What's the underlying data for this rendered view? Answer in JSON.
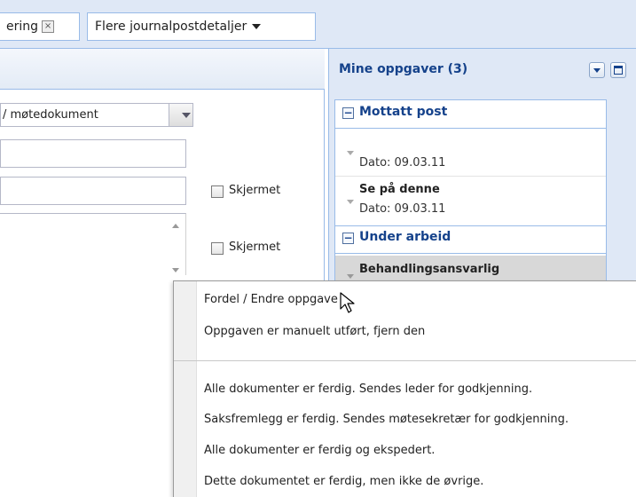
{
  "tabs": {
    "registrering": {
      "label": "ering",
      "close": "×"
    },
    "more_details": {
      "label": "Flere journalpostdetaljer"
    }
  },
  "form": {
    "document_type_value": "/ møtedokument",
    "checkbox1_label": "Skjermet",
    "checkbox2_label": "Skjermet"
  },
  "tasks_panel": {
    "title": "Mine oppgaver (3)",
    "groups": [
      {
        "title": "Mottatt post",
        "toggle": "−"
      },
      {
        "title": "Under arbeid",
        "toggle": "−"
      }
    ],
    "tasks": [
      {
        "title": "",
        "date": "Dato: 09.03.11"
      },
      {
        "title": "Se på denne",
        "date": "Dato: 09.03.11"
      },
      {
        "title": "Behandlingsansvarlig",
        "date": ""
      }
    ]
  },
  "context_menu": {
    "items_top": [
      "Fordel / Endre oppgave",
      "Oppgaven er manuelt utført, fjern den"
    ],
    "items_bottom": [
      "Alle dokumenter er ferdig. Sendes leder for godkjenning.",
      "Saksfremlegg er ferdig. Sendes møtesekretær for godkjenning.",
      "Alle dokumenter er ferdig og ekspedert.",
      "Dette dokumentet er ferdig, men ikke de øvrige."
    ]
  },
  "colors": {
    "header_blue": "#15428b",
    "panel_bg": "#dfe8f6",
    "border_blue": "#99bbe8"
  }
}
